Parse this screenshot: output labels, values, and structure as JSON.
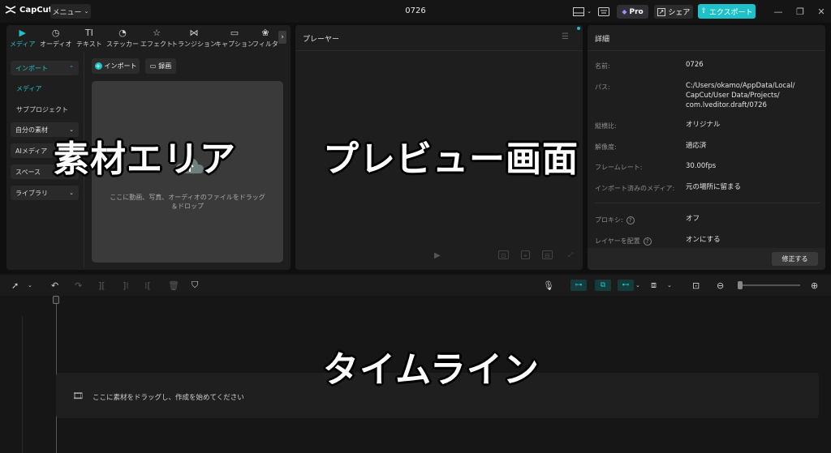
{
  "app": {
    "logo_text": "CapCut",
    "menu_label": "メニュー",
    "project_title": "0726"
  },
  "titlebar": {
    "pro_label": "Pro",
    "share_label": "シェア",
    "export_label": "エクスポート"
  },
  "media_tabs": [
    {
      "label": "メディア",
      "icon": "media-icon"
    },
    {
      "label": "オーディオ",
      "icon": "audio-icon"
    },
    {
      "label": "テキスト",
      "icon": "text-icon"
    },
    {
      "label": "ステッカー",
      "icon": "sticker-icon"
    },
    {
      "label": "エフェクト",
      "icon": "effect-icon"
    },
    {
      "label": "トランジション",
      "icon": "transition-icon"
    },
    {
      "label": "キャプション",
      "icon": "caption-icon"
    },
    {
      "label": "フィルタ",
      "icon": "filter-icon"
    }
  ],
  "sidebar": {
    "import_label": "インポート",
    "media_label": "メディア",
    "subproject_label": "サブプロジェクト",
    "my_assets_label": "自分の素材",
    "ai_media_label": "AIメディア",
    "space_label": "スペース",
    "library_label": "ライブラリ"
  },
  "media": {
    "import_button": "インポート",
    "record_button": "録画",
    "drop_text": "ここに動画、写真、オーディオのファイルをドラッグ＆ドロップ"
  },
  "player": {
    "title": "プレーヤー"
  },
  "details": {
    "title": "詳細",
    "rows": [
      {
        "label": "名前:",
        "value": "0726"
      },
      {
        "label": "パス:",
        "value": "C:/Users/okamo/AppData/Local/ CapCut/User Data/Projects/ com.lveditor.draft/0726"
      },
      {
        "label": "縦横比:",
        "value": "オリジナル"
      },
      {
        "label": "解像度:",
        "value": "適応済"
      },
      {
        "label": "フレームレート:",
        "value": "30.00fps"
      },
      {
        "label": "インポート済みのメディア:",
        "value": "元の場所に留まる"
      },
      {
        "label": "プロキシ:",
        "value": "オフ"
      },
      {
        "label": "レイヤーを配置",
        "value": "オンにする"
      }
    ],
    "modify_button": "修正する"
  },
  "timeline": {
    "drop_text": "ここに素材をドラッグし、作成を始めてください"
  },
  "overlays": {
    "media_area": "素材エリア",
    "preview_screen": "プレビュー画面",
    "timeline": "タイムライン"
  },
  "colors": {
    "accent": "#1ec1c7",
    "panel": "#1e1e1e",
    "background": "#0f0f10"
  }
}
